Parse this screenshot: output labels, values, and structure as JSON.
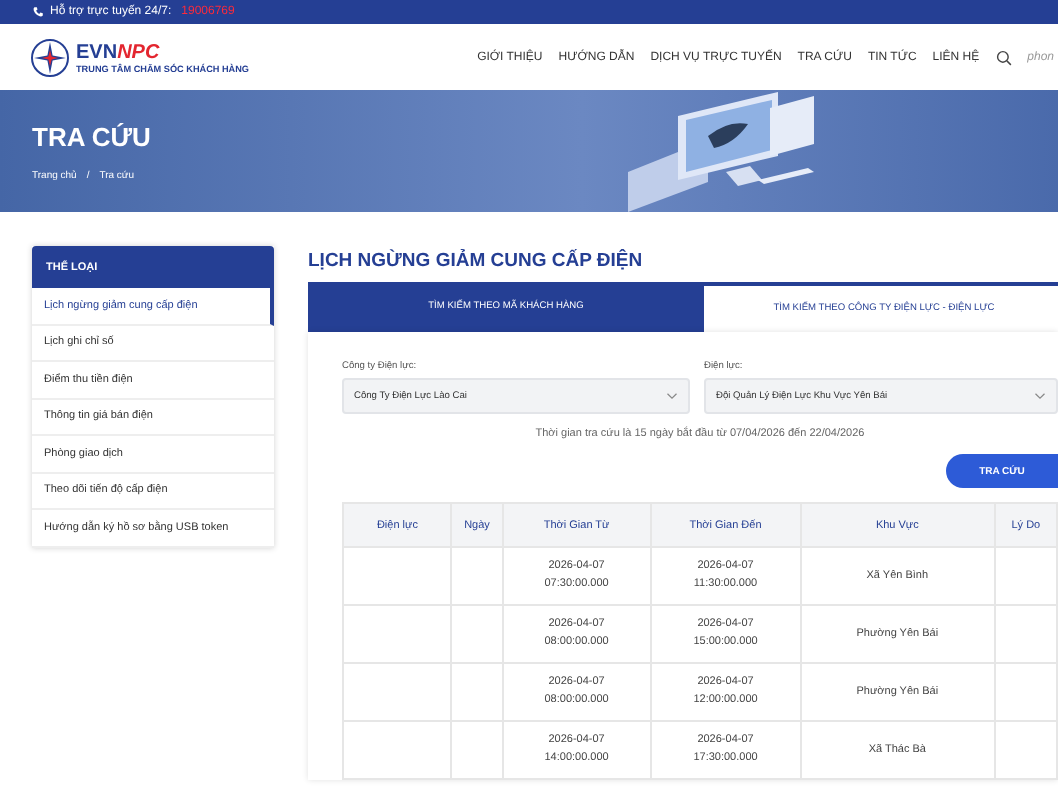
{
  "top_bar": {
    "support_label": "Hỗ trợ trực tuyến 24/7:",
    "hotline": "19006769"
  },
  "header": {
    "logo": {
      "brand_evn": "EVN",
      "brand_npc": "NPC",
      "subtitle": "TRUNG TÂM CHĂM SÓC KHÁCH HÀNG"
    },
    "nav": [
      {
        "label": "GIỚI THIỆU",
        "selected": false
      },
      {
        "label": "HƯỚNG DẪN",
        "selected": false
      },
      {
        "label": "DỊCH VỤ TRỰC TUYẾN",
        "selected": false
      },
      {
        "label": "TRA CỨU",
        "selected": false
      },
      {
        "label": "TIN TỨC",
        "selected": false
      },
      {
        "label": "LIÊN HỆ",
        "selected": false
      }
    ],
    "search_hint": "phon"
  },
  "banner": {
    "title": "TRA CỨU",
    "breadcrumb": {
      "separator": "/",
      "items": [
        "Trang chủ",
        "Tra cứu"
      ]
    }
  },
  "sidebar": {
    "title": "THỂ LOẠI",
    "items": [
      {
        "label": "Lịch ngừng giảm cung cấp điện",
        "selected": true
      },
      {
        "label": "Lịch ghi chỉ số",
        "selected": false
      },
      {
        "label": "Điểm thu tiền điện",
        "selected": false
      },
      {
        "label": "Thông tin giá bán điện",
        "selected": false
      },
      {
        "label": "Phòng giao dịch",
        "selected": false
      },
      {
        "label": "Theo dõi tiến độ cấp điện",
        "selected": false
      },
      {
        "label": "Hướng dẫn ký hồ sơ bằng USB token",
        "selected": false
      }
    ]
  },
  "main": {
    "title": "LỊCH NGỪNG GIẢM CUNG CẤP ĐIỆN",
    "tabs": [
      {
        "label": "TÌM KIẾM THEO MÃ KHÁCH HÀNG",
        "selected": false
      },
      {
        "label": "TÌM KIẾM THEO CÔNG TY ĐIỆN LỰC - ĐIỆN LỰC",
        "selected": true
      }
    ],
    "fields": [
      {
        "label": "Công ty Điện lực:",
        "value": "Công Ty Điện Lực Lào Cai"
      },
      {
        "label": "Điện lực:",
        "value": "Đội Quản Lý Điện Lực Khu Vực Yên Bái"
      }
    ],
    "note": "Thời gian tra cứu là 15 ngày bắt đầu từ 07/04/2026 đến 22/04/2026",
    "search_button": "TRA CỨU",
    "table": {
      "columns": [
        "Điện lực",
        "Ngày",
        "Thời Gian Từ",
        "Thời Gian Đến",
        "Khu Vực",
        "Lý Do"
      ],
      "rows": [
        [
          "",
          "",
          "2026-04-07\n07:30:00.000",
          "2026-04-07\n11:30:00.000",
          "Xã Yên Bình",
          ""
        ],
        [
          "",
          "",
          "2026-04-07\n08:00:00.000",
          "2026-04-07\n15:00:00.000",
          "Phường Yên Bái",
          ""
        ],
        [
          "",
          "",
          "2026-04-07\n08:00:00.000",
          "2026-04-07\n12:00:00.000",
          "Phường Yên Bái",
          ""
        ],
        [
          "",
          "",
          "2026-04-07\n14:00:00.000",
          "2026-04-07\n17:30:00.000",
          "Xã Thác Bà",
          ""
        ]
      ]
    }
  }
}
